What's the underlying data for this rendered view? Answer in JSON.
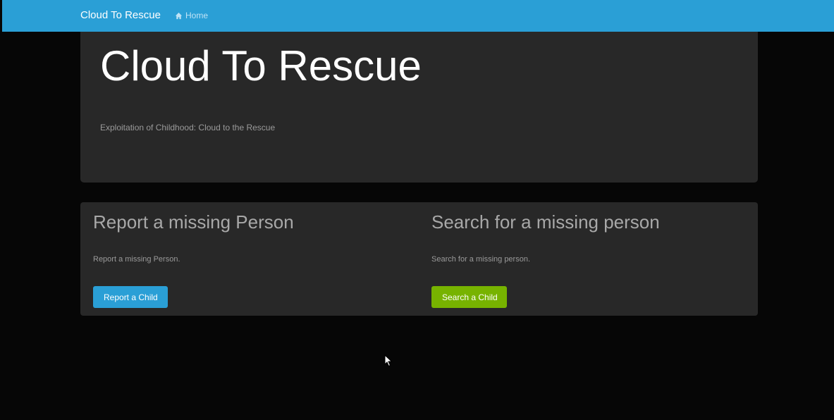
{
  "navbar": {
    "brand": "Cloud To Rescue",
    "home_label": "Home",
    "home_icon": "home-icon",
    "background": "#2a9fd6"
  },
  "jumbotron": {
    "title": "Cloud To Rescue",
    "subtitle": "Exploitation of Childhood: Cloud to the Rescue"
  },
  "report_section": {
    "title": "Report a missing Person",
    "description": "Report a missing Person.",
    "button_label": "Report a Child",
    "button_color": "#2a9fd6"
  },
  "search_section": {
    "title": "Search for a missing person",
    "description": "Search for a missing person.",
    "button_label": "Search a Child",
    "button_color": "#77b300"
  }
}
